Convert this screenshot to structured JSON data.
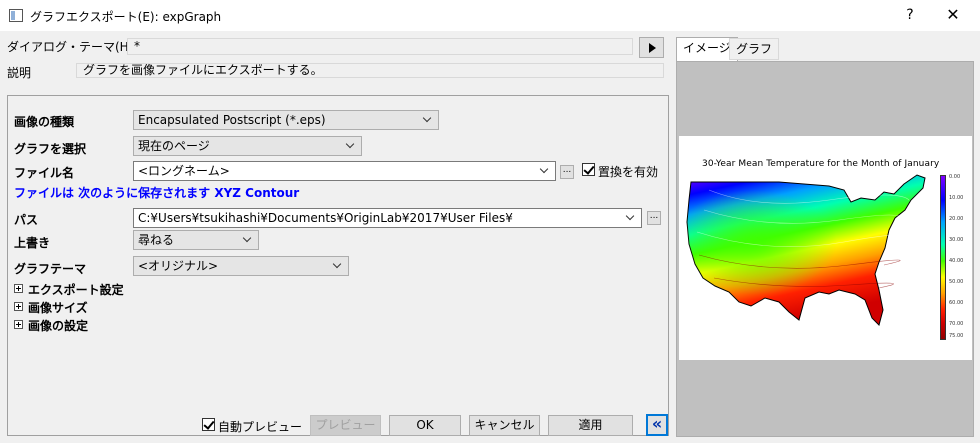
{
  "window": {
    "title": "グラフエクスポート(E): expGraph",
    "help": "?",
    "close": "✕"
  },
  "dialog_theme": {
    "label": "ダイアログ・テーマ(H)",
    "value": "*"
  },
  "description": {
    "label": "説明",
    "value": "グラフを画像ファイルにエクスポートする。"
  },
  "form": {
    "image_type": {
      "label": "画像の種類",
      "value": "Encapsulated Postscript (*.eps)"
    },
    "select_graph": {
      "label": "グラフを選択",
      "value": "現在のページ"
    },
    "file_name": {
      "label": "ファイル名",
      "value": "<ロングネーム>",
      "browse": "...",
      "replace_label": "置換を有効",
      "replace_checked": true
    },
    "save_as_info": "ファイルは 次のように保存されます XYZ Contour",
    "path": {
      "label": "パス",
      "value": "C:¥Users¥tsukihashi¥Documents¥OriginLab¥2017¥User Files¥",
      "browse": "..."
    },
    "overwrite": {
      "label": "上書き",
      "value": "尋ねる"
    },
    "graph_theme": {
      "label": "グラフテーマ",
      "value": "<オリジナル>"
    },
    "sections": [
      {
        "label": "エクスポート設定"
      },
      {
        "label": "画像サイズ"
      },
      {
        "label": "画像の設定"
      }
    ]
  },
  "bottom": {
    "auto_preview_label": "自動プレビュー",
    "auto_preview_checked": true,
    "preview_button": "プレビュー",
    "ok_button": "OK",
    "cancel_button": "キャンセル",
    "apply_button": "適用",
    "collapse_button": "«"
  },
  "tabs": [
    {
      "label": "イメージ",
      "active": true
    },
    {
      "label": "グラフ",
      "active": false
    }
  ],
  "preview": {
    "map_title": "30-Year Mean Temperature for the Month of January",
    "colorbar_labels": [
      "0.00",
      "10.00",
      "20.00",
      "30.00",
      "40.00",
      "50.00",
      "60.00",
      "70.00",
      "75.00"
    ],
    "colors": {
      "coldest": "#7f00ff",
      "cold": "#0000ff",
      "cool": "#00a0ff",
      "mild": "#00ffb0",
      "green": "#40ff00",
      "warm": "#ffff00",
      "hot": "#ffa000",
      "hotter": "#ff2000",
      "hottest": "#900000"
    }
  }
}
